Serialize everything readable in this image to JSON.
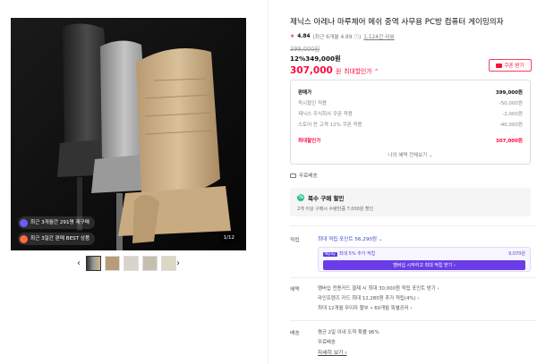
{
  "gallery": {
    "badge1": "최근 3개월간 291명 재구매",
    "badge2": "최근 3일간 판매 BEST 상품",
    "counter": "1/12",
    "prev_arrow": "‹",
    "next_arrow": "›"
  },
  "product": {
    "title": "제닉스 아레나 마루체어 메쉬 중역 사무용 PC방 컴퓨터 게이밍의자",
    "rating_score": "4.84",
    "rating_detail": "(최근 6개월 4.89 ⓘ)",
    "review_count": "1,124건 리뷰",
    "original_price": "399,000원",
    "discount_line": "12%349,000원",
    "final_price": "307,000",
    "final_unit": "원",
    "final_label": "최대할인가 ⌃",
    "coupon_label": "쿠폰 받기"
  },
  "price_box": {
    "rows": [
      {
        "label": "판매가",
        "value": "399,000원"
      },
      {
        "label": "즉시할인 적용",
        "value": "-50,000원"
      },
      {
        "label": "제닉스 주식회사 쿠폰 적용",
        "value": "-2,000원"
      },
      {
        "label": "스토어 찬 고객 12% 쿠폰 적용",
        "value": "-40,000원"
      }
    ],
    "total_label": "최대할인가",
    "total_value": "307,000원",
    "more": "나의 혜택 전체보기 ⌄"
  },
  "shipping_note": "무료배송",
  "multi_buy": {
    "title": "복수 구매 할인",
    "sub": "2개 이상 구매시 수량만큼 7,000원 할인"
  },
  "points": {
    "label": "적립",
    "line": "최대 적립 포인트 56,290원 ⌄",
    "box_text": "최대 5% 추가 적립",
    "box_value": "9,070원",
    "box_tag": "Npay",
    "button": "멤버십 시작하고 최대 적립 받기 ›"
  },
  "benefits": {
    "label": "혜택",
    "lines": [
      "멤버십 전용카드 결제 시 최대 30,000원 적립 포인트 받기 ›",
      "라인프렌즈 카드 최대 12,280원 추가 적립(4%) ›",
      "최대 12개월 무이자 할부 • 60개월 특별공리 ›"
    ]
  },
  "delivery": {
    "label": "배송",
    "line1": "평균 2일 이내 도착 확률 96%",
    "line2": "무료배송",
    "link": "자세히 보기 ›"
  },
  "colors": {
    "accent": "#ff0a3e",
    "points": "#3a48c7",
    "purple": "#6a3de8"
  }
}
